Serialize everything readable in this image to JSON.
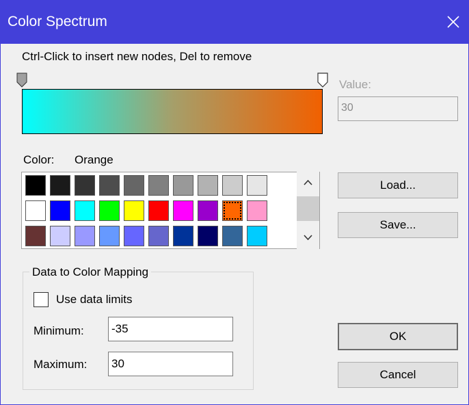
{
  "window": {
    "title": "Color Spectrum"
  },
  "hint": "Ctrl-Click to insert new nodes, Del to remove",
  "gradient": {
    "start_color": "#00ffff",
    "mid_color": "#a59f6a",
    "end_color": "#f16000"
  },
  "value": {
    "label": "Value:",
    "text": "30"
  },
  "color": {
    "label": "Color:",
    "name": "Orange"
  },
  "palette": {
    "selected": "#ff6600",
    "swatches": [
      "#000000",
      "#1a1a1a",
      "#333333",
      "#4d4d4d",
      "#666666",
      "#808080",
      "#999999",
      "#b2b2b2",
      "#cccccc",
      "#e6e6e6",
      "#ffffff",
      "#0000ff",
      "#00ffff",
      "#00ff00",
      "#ffff00",
      "#ff0000",
      "#ff00ff",
      "#9900cc",
      "#ff6600",
      "#ff99cc",
      "#663333",
      "#ccccff",
      "#9999ff",
      "#6699ff",
      "#6666ff",
      "#6666cc",
      "#003399",
      "#000066",
      "#336699",
      "#00ccff"
    ]
  },
  "buttons": {
    "load": "Load...",
    "save": "Save...",
    "ok": "OK",
    "cancel": "Cancel"
  },
  "mapping": {
    "group_title": "Data to Color Mapping",
    "use_data_limits": {
      "label": "Use data limits",
      "checked": false
    },
    "minimum": {
      "label": "Minimum:",
      "value": "-35"
    },
    "maximum": {
      "label": "Maximum:",
      "value": "30"
    }
  }
}
